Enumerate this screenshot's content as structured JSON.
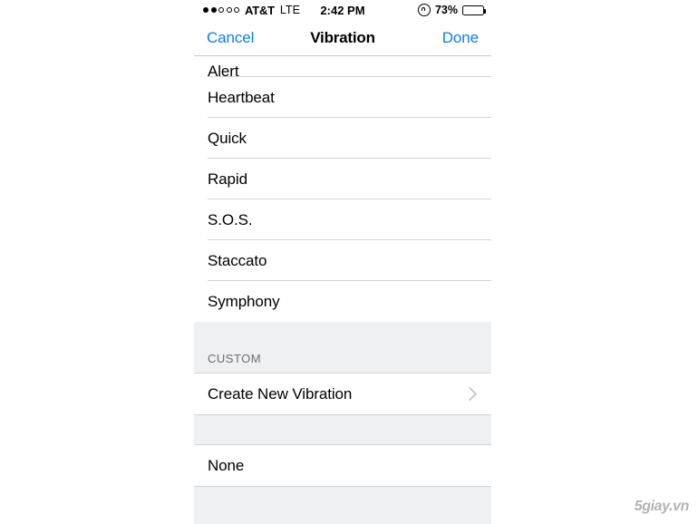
{
  "status_bar": {
    "signal_dots_filled": 2,
    "signal_dots_total": 5,
    "carrier": "AT&T",
    "network": "LTE",
    "time": "2:42 PM",
    "rotation_lock_icon": "rotation-lock-icon",
    "battery_percent": "73%",
    "battery_level": 73
  },
  "nav_bar": {
    "cancel_label": "Cancel",
    "title": "Vibration",
    "done_label": "Done"
  },
  "list": {
    "standard_items": [
      {
        "label": "Alert",
        "clipped": true
      },
      {
        "label": "Heartbeat",
        "clipped": false
      },
      {
        "label": "Quick",
        "clipped": false
      },
      {
        "label": "Rapid",
        "clipped": false
      },
      {
        "label": "S.O.S.",
        "clipped": false
      },
      {
        "label": "Staccato",
        "clipped": false
      },
      {
        "label": "Symphony",
        "clipped": false
      }
    ],
    "custom_section": {
      "header": "CUSTOM",
      "items": [
        {
          "label": "Create New Vibration",
          "accessory": "chevron-right-icon"
        }
      ]
    },
    "none_section": {
      "items": [
        {
          "label": "None"
        }
      ]
    }
  },
  "watermark": {
    "text": "5giay.vn"
  },
  "colors": {
    "accent_blue": "#0a7cff",
    "group_background": "#eff0f2",
    "separator": "#d4d4d8",
    "header_text": "#6d6d72"
  }
}
